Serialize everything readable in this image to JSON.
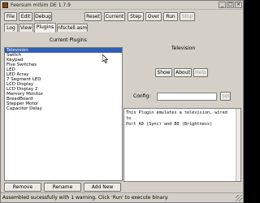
{
  "window": {
    "title": "Feersum miSim DE 1.7.9",
    "minimize": "_",
    "maximize": "□",
    "close": "×"
  },
  "toolbar": {
    "file": "File",
    "edit": "Edit",
    "debug": "Debug",
    "reset": "Reset",
    "current": "Current",
    "step": "Step",
    "over": "Over",
    "run": "Run",
    "stop": "Stop"
  },
  "tabs": [
    "Log",
    "View",
    "Plugins",
    "nfsctell.asm"
  ],
  "current_plugins_label": "Current Plugins",
  "plugins": [
    "Television",
    "Switch",
    "Keypad",
    "Five Switches",
    "LED",
    "LED Array",
    "7 Segment LED",
    "LCD Display",
    "LCD Display 2",
    "Memory Monitor",
    "BreadBoard",
    "Stepper Motor",
    "Capacitor Delay"
  ],
  "list_buttons": {
    "remove": "Remove",
    "rename": "Rename",
    "add_new": "Add New"
  },
  "plugin_detail": {
    "name": "Television",
    "show": "Show",
    "about": "About",
    "help": "Help",
    "config_label": "Config:",
    "config_value": "",
    "set": "Set",
    "description": "This Plugin emulates a television, wired to\nPort A0 (Sync) and B0 (Brightness)"
  },
  "status": "Assembled sucessfully with 1 warning. Click 'Run' to execute binary."
}
